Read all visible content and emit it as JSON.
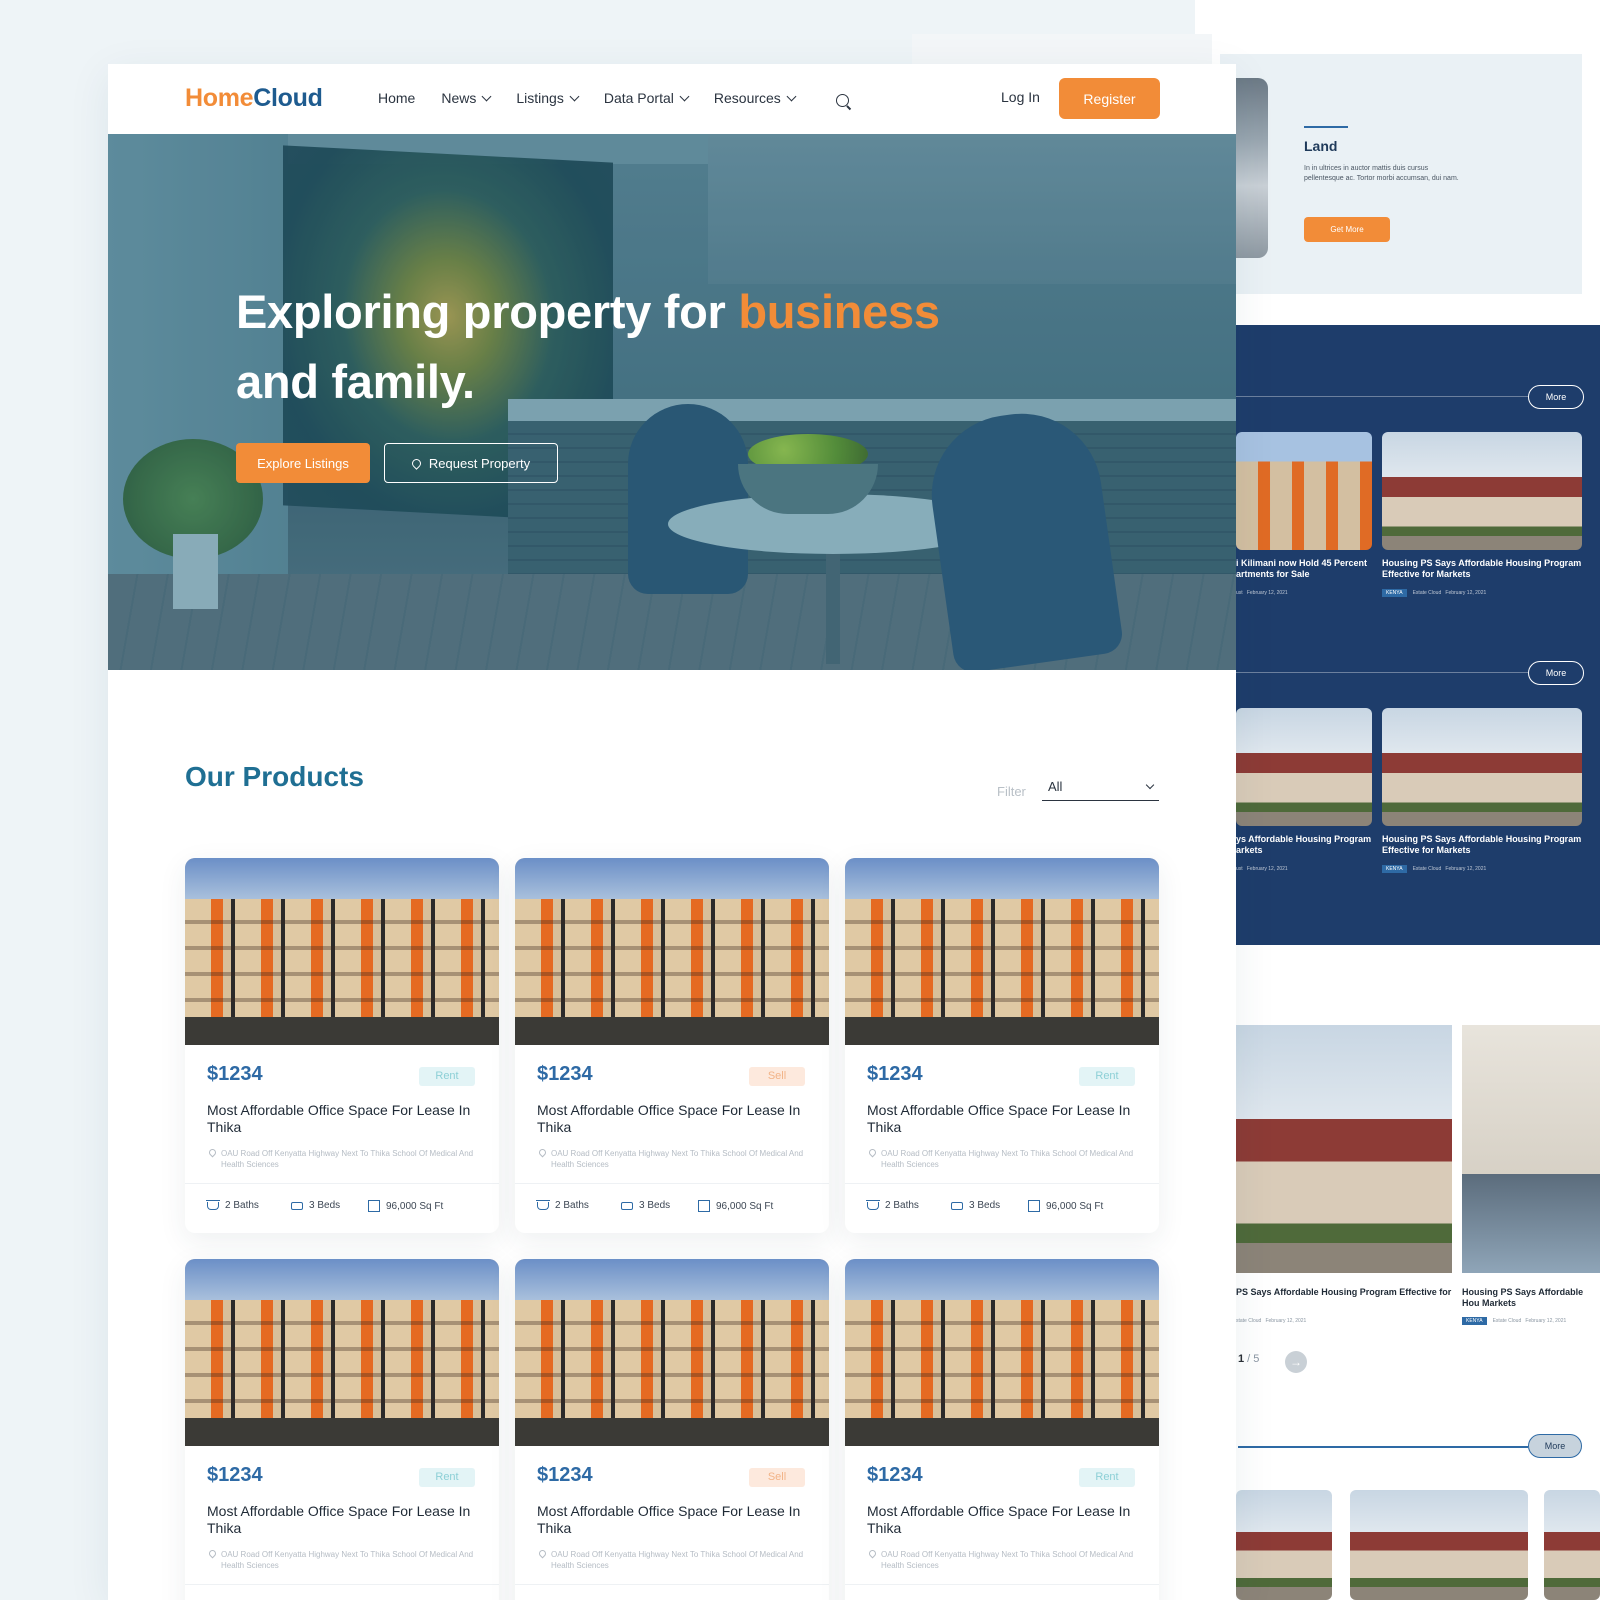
{
  "brand": {
    "part1": "Home",
    "part2": "Cloud"
  },
  "nav": {
    "items": [
      {
        "label": "Home",
        "dropdown": false
      },
      {
        "label": "News",
        "dropdown": true
      },
      {
        "label": "Listings",
        "dropdown": true
      },
      {
        "label": "Data Portal",
        "dropdown": true
      },
      {
        "label": "Resources",
        "dropdown": true
      }
    ],
    "login": "Log In",
    "register": "Register"
  },
  "hero": {
    "title_part1": "Exploring property for ",
    "title_accent": "business",
    "title_part2": "and family.",
    "explore_label": "Explore Listings",
    "request_label": "Request Property"
  },
  "products": {
    "title": "Our Products",
    "filter_label": "Filter",
    "filter_value": "All",
    "cards": [
      {
        "price": "$1234",
        "badge": "Rent",
        "title": "Most Affordable Office Space For Lease In Thika",
        "address": "OAU Road Off Kenyatta Highway Next To Thika School Of Medical And Health Sciences",
        "baths": "2 Baths",
        "beds": "3 Beds",
        "area": "96,000 Sq Ft"
      },
      {
        "price": "$1234",
        "badge": "Sell",
        "title": "Most Affordable Office Space For Lease In Thika",
        "address": "OAU Road Off Kenyatta Highway Next To Thika School Of Medical And Health Sciences",
        "baths": "2 Baths",
        "beds": "3 Beds",
        "area": "96,000 Sq Ft"
      },
      {
        "price": "$1234",
        "badge": "Rent",
        "title": "Most Affordable Office Space For Lease In Thika",
        "address": "OAU Road Off Kenyatta Highway Next To Thika School Of Medical And Health Sciences",
        "baths": "2 Baths",
        "beds": "3 Beds",
        "area": "96,000 Sq Ft"
      },
      {
        "price": "$1234",
        "badge": "Rent",
        "title": "Most Affordable Office Space For Lease In Thika",
        "address": "OAU Road Off Kenyatta Highway Next To Thika School Of Medical And Health Sciences"
      },
      {
        "price": "$1234",
        "badge": "Sell",
        "title": "Most Affordable Office Space For Lease In Thika",
        "address": "OAU Road Off Kenyatta Highway Next To Thika School Of Medical And Health Sciences"
      },
      {
        "price": "$1234",
        "badge": "Rent",
        "title": "Most Affordable Office Space For Lease In Thika",
        "address": "OAU Road Off Kenyatta Highway Next To Thika School Of Medical And Health Sciences"
      }
    ]
  },
  "side": {
    "land": {
      "title": "Land",
      "text": "In in ultrices in auctor mattis duis cursus pellentesque ac. Tortor morbi accumsan, dui nam.",
      "button": "Get More"
    },
    "more_label": "More",
    "news": [
      {
        "caption": "i Kilimani now Hold 45 Percent artments for Sale",
        "tag": "",
        "source": "ust",
        "date": "February 12, 2021"
      },
      {
        "caption": "Housing PS Says Affordable Housing Program Effective for Markets",
        "tag": "KENYA",
        "source": "Estate Cloud",
        "date": "February 12, 2021"
      },
      {
        "caption": "ys Affordable Housing Program arkets",
        "tag": "",
        "source": "ust",
        "date": "February 12, 2021"
      },
      {
        "caption": "Housing PS Says Affordable Housing Program Effective for Markets",
        "tag": "KENYA",
        "source": "Estate Cloud",
        "date": "February 12, 2021"
      }
    ],
    "lower_news": [
      {
        "caption": "PS Says Affordable Housing Program Effective for",
        "source": "state Cloud",
        "date": "February 12, 2021"
      },
      {
        "caption": "Housing PS Says Affordable Hou Markets",
        "tag": "KENYA",
        "source": "Estate Cloud",
        "date": "February 12, 2021"
      }
    ],
    "pager": {
      "current": "1",
      "sep": " / ",
      "total": "5",
      "next": "→"
    }
  },
  "colors": {
    "accent": "#f28c38",
    "brand_blue": "#1e5b8f",
    "navy": "#1e3d6b",
    "price_blue": "#2e6aa5"
  }
}
